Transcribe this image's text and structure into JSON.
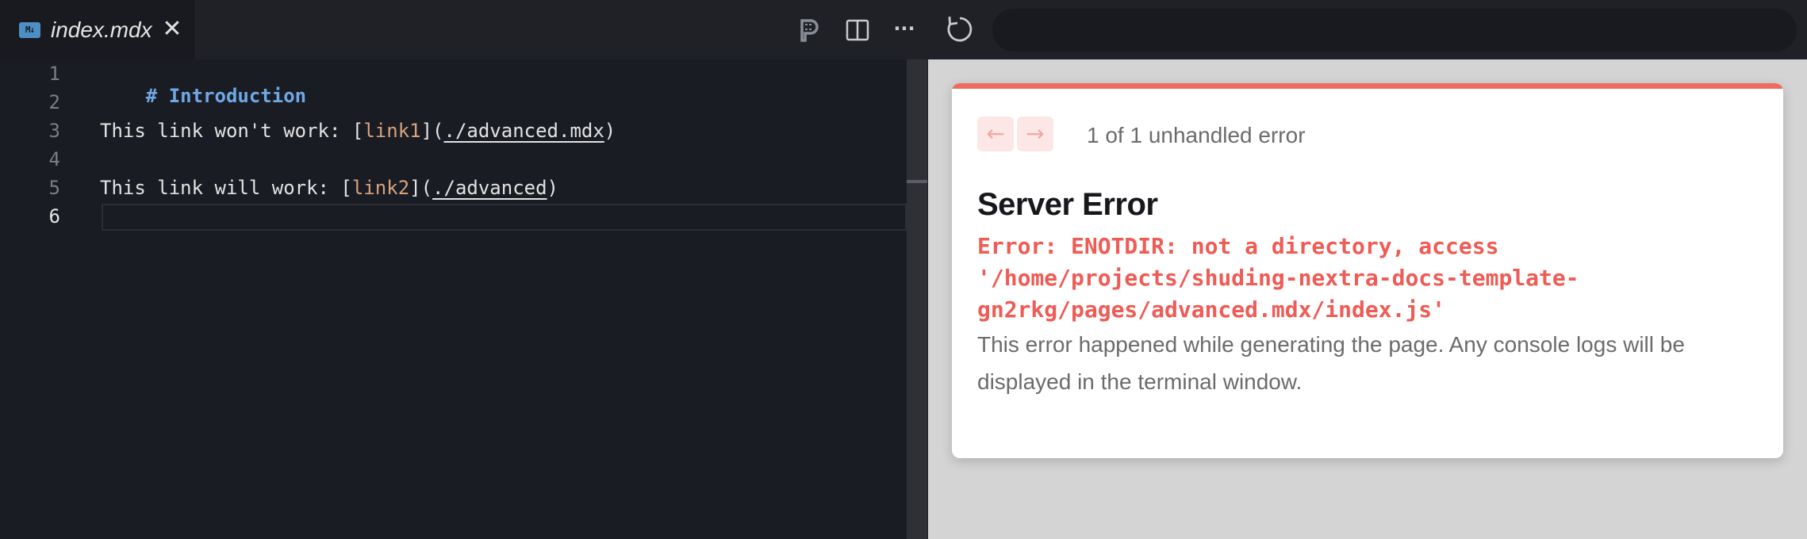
{
  "tab": {
    "icon": "markdown-icon",
    "icon_text": "M↓",
    "title": "index.mdx",
    "close_glyph": "✕"
  },
  "toolbar": {
    "icons": [
      "prettier-p-icon",
      "split-editor-icon",
      "more-actions-icon",
      "refresh-icon"
    ],
    "more_glyph": "···",
    "address_value": ""
  },
  "editor": {
    "line_numbers": [
      "1",
      "2",
      "3",
      "4",
      "5",
      "6"
    ],
    "active_line": "6",
    "lines": {
      "l1": {
        "heading": "# Introduction"
      },
      "l3": {
        "prefix": "This link won't work: [",
        "link_text": "link1",
        "mid": "](",
        "url": "./advanced.mdx",
        "suffix": ")"
      },
      "l5": {
        "prefix": "This link will work: [",
        "link_text": "link2",
        "mid": "](",
        "url": "./advanced",
        "suffix": ")"
      }
    }
  },
  "error_overlay": {
    "prev_glyph": "←",
    "next_glyph": "→",
    "count_label": "1 of 1 unhandled error",
    "title": "Server Error",
    "message": "Error: ENOTDIR: not a directory, access\n'/home/projects/shuding-nextra-docs-template-\ngn2rkg/pages/advanced.mdx/index.js'",
    "description": "This error happened while generating the page. Any console logs will be displayed in the terminal window."
  },
  "colors": {
    "editor_bg": "#1a1c23",
    "heading": "#6fa8e6",
    "link_text": "#d7a37e",
    "error_accent": "#ef5b55",
    "preview_bg": "#d4d4d4"
  }
}
